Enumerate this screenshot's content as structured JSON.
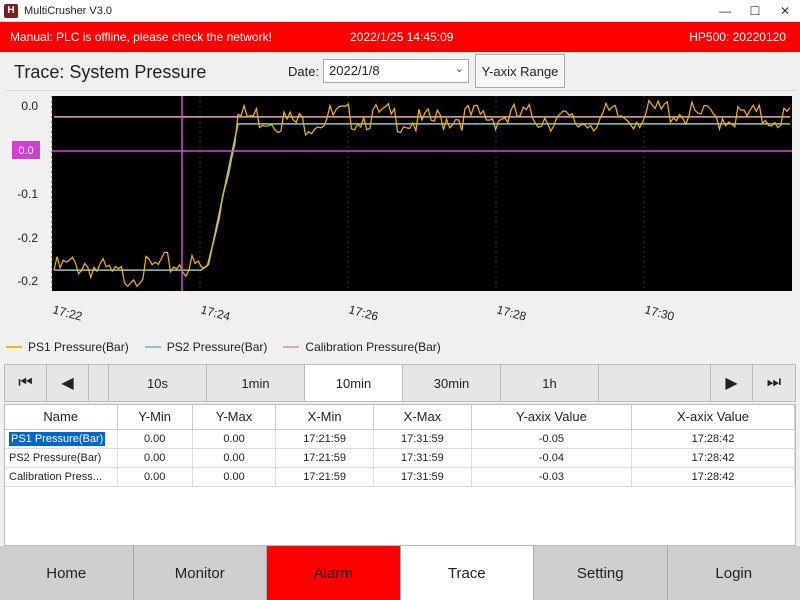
{
  "window": {
    "title": "MultiCrusher V3.0",
    "icon": "H",
    "minimize": "—",
    "maximize": "☐",
    "close": "✕"
  },
  "banner": {
    "message": "Manual:  PLC is offline, please check the network!",
    "datetime": "2022/1/25 14:45:09",
    "model": "HP500:  20220120"
  },
  "trace": {
    "title": "Trace:  System Pressure",
    "date_label": "Date:",
    "date_value": "2022/1/8",
    "yrange_label": "Y-axix Range"
  },
  "colors": {
    "ps1": "#f5b800",
    "ps2": "#8fc5c0",
    "calibration": "#e8a8a0",
    "cursor": "#e040e0",
    "banner": "#ff0000"
  },
  "chart_data": {
    "type": "line",
    "y_ticks": [
      "0.0",
      "0.0",
      "-0.1",
      "-0.2",
      "-0.2"
    ],
    "x_ticks": [
      "17:22",
      "17:24",
      "17:26",
      "17:28",
      "17:30"
    ],
    "cursor_label": "0.0",
    "series": [
      {
        "name": "PS1 Pressure(Bar)",
        "values": [
          -0.22,
          -0.21,
          -0.23,
          -0.22,
          -0.21,
          -0.22,
          0.0,
          0.0,
          -0.01,
          0.0,
          0.0,
          0.0,
          -0.01,
          0.0,
          0.0,
          0.0,
          0.0,
          -0.01,
          0.0,
          0.0,
          0.01,
          0.0,
          0.0,
          0.0,
          0.0
        ]
      },
      {
        "name": "PS2 Pressure(Bar)",
        "values": [
          -0.22,
          -0.22,
          -0.22,
          -0.22,
          -0.22,
          -0.22,
          -0.01,
          -0.01,
          -0.01,
          -0.01,
          -0.01,
          -0.01,
          -0.01,
          -0.01,
          -0.01,
          -0.01,
          -0.01,
          -0.01,
          -0.01,
          -0.01,
          -0.01,
          -0.01,
          -0.01,
          -0.01,
          -0.01
        ]
      },
      {
        "name": "Calibration Pressure(Bar)",
        "values": [
          0.0,
          0.0,
          0.0,
          0.0,
          0.0,
          0.0,
          0.0,
          0.0,
          0.0,
          0.0,
          0.0,
          0.0,
          0.0,
          0.0,
          0.0,
          0.0,
          0.0,
          0.0,
          0.0,
          0.0,
          0.0,
          0.0,
          0.0,
          0.0,
          0.0
        ]
      }
    ]
  },
  "nav": {
    "first": "⏮",
    "prev": "◀",
    "ranges": [
      "10s",
      "1min",
      "10min",
      "30min",
      "1h"
    ],
    "active_range": "10min",
    "next": "▶",
    "last": "⏭"
  },
  "table": {
    "headers": [
      "Name",
      "Y-Min",
      "Y-Max",
      "X-Min",
      "X-Max",
      "Y-axix Value",
      "X-axix Value"
    ],
    "rows": [
      [
        "PS1 Pressure(Bar)",
        "0.00",
        "0.00",
        "17:21:59",
        "17:31:59",
        "-0.05",
        "17:28:42"
      ],
      [
        "PS2 Pressure(Bar)",
        "0.00",
        "0.00",
        "17:21:59",
        "17:31:59",
        "-0.04",
        "17:28:42"
      ],
      [
        "Calibration Press...",
        "0.00",
        "0.00",
        "17:21:59",
        "17:31:59",
        "-0.03",
        "17:28:42"
      ]
    ]
  },
  "bottom_nav": [
    "Home",
    "Monitor",
    "Alarm",
    "Trace",
    "Setting",
    "Login"
  ]
}
